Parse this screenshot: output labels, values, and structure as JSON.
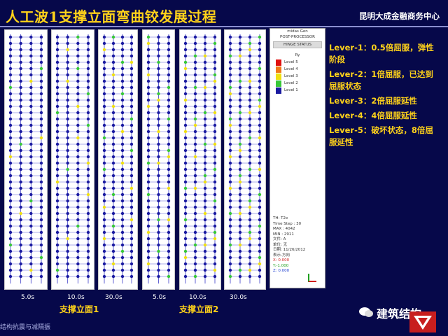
{
  "header": {
    "title": "人工波1支撑立面弯曲铰发展过程",
    "org": "昆明大成金融商务中心"
  },
  "panels": [
    {
      "time": "5.0s"
    },
    {
      "time": "10.0s"
    },
    {
      "time": "30.0s"
    },
    {
      "time": "5.0s"
    },
    {
      "time": "10.0s"
    },
    {
      "time": "30.0s"
    }
  ],
  "groups": {
    "group1": "支撑立面1",
    "group2": "支撑立面2"
  },
  "legend": {
    "app": "midas Gen",
    "mode": "POST-PROCESSOR",
    "status": "HINGE STATUS",
    "axis": "Ry",
    "levels": [
      {
        "label": "Level 5",
        "color": "#e01010"
      },
      {
        "label": "Level 4",
        "color": "#f07818"
      },
      {
        "label": "Level 3",
        "color": "#f0e010"
      },
      {
        "label": "Level 2",
        "color": "#38c838"
      },
      {
        "label": "Level 1",
        "color": "#1a1aa0"
      }
    ],
    "th": "TH: T2x",
    "step": "Time Step : 30",
    "max": "MAX : 4042",
    "min": "MIN : 2911",
    "file": "文件: A",
    "unit": "单位: 无",
    "date": "日期: 11/26/2012",
    "view": "表示-方向",
    "x": "X: 0.000",
    "y": "Y:-1.000",
    "z": "Z: 0.000"
  },
  "notes": [
    "Lever-1：0.5倍屈服，弹性阶段",
    "Lever-2：1倍屈服，已达到屈服状态",
    "Lever-3：2倍屈服延性",
    "Lever-4：4倍屈服延性",
    "Lever-5：破坏状态，8倍屈服延性"
  ],
  "footer": {
    "left": "结构抗震与减隔振",
    "brand": "建筑结构"
  }
}
